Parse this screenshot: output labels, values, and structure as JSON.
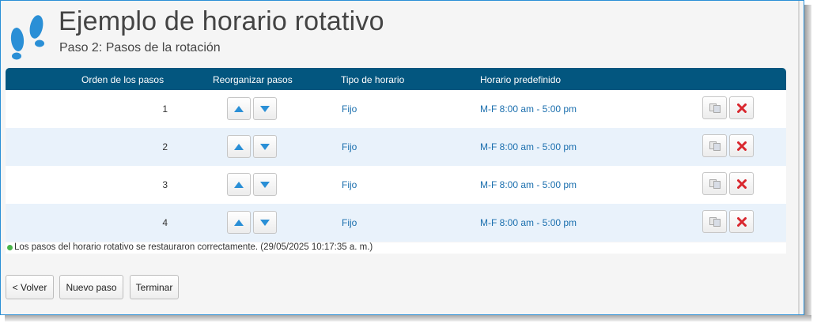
{
  "header": {
    "title": "Ejemplo de horario rotativo",
    "subtitle": "Paso 2: Pasos de la rotación",
    "logo_icon": "footprints-icon"
  },
  "table": {
    "columns": [
      "Orden de los pasos",
      "Reorganizar pasos",
      "Tipo de horario",
      "Horario predefinido"
    ],
    "rows": [
      {
        "order": "1",
        "type": "Fijo",
        "schedule": "M-F 8:00 am - 5:00 pm"
      },
      {
        "order": "2",
        "type": "Fijo",
        "schedule": "M-F 8:00 am - 5:00 pm"
      },
      {
        "order": "3",
        "type": "Fijo",
        "schedule": "M-F 8:00 am - 5:00 pm"
      },
      {
        "order": "4",
        "type": "Fijo",
        "schedule": "M-F 8:00 am - 5:00 pm"
      }
    ],
    "row_icons": [
      "move-up-icon",
      "move-down-icon",
      "copy-icon",
      "delete-icon"
    ]
  },
  "status": {
    "message": "Los pasos del horario rotativo se restauraron correctamente. (29/05/2025 10:17:35 a. m.)",
    "icon": "success-dot-icon"
  },
  "buttons": {
    "back": "< Volver",
    "new_step": "Nuevo paso",
    "finish": "Terminar"
  },
  "colors": {
    "header_bg": "#03567f",
    "link": "#1b6fae",
    "alt_row": "#e9f2fb",
    "icon_blue": "#2a8fd6",
    "delete_red": "#d9272e"
  }
}
